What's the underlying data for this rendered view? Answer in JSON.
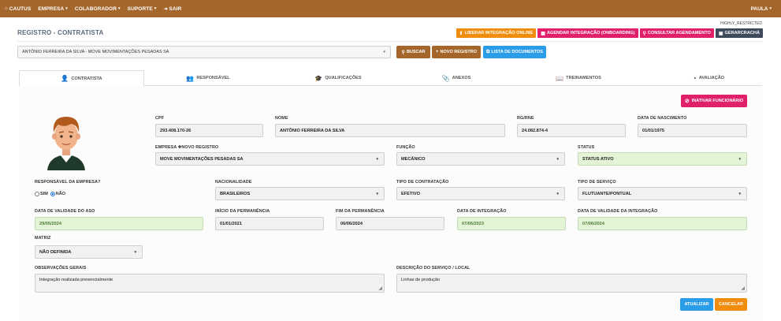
{
  "nav": {
    "items": [
      {
        "label": "CAUTUS",
        "icon": "home-icon",
        "caret": false
      },
      {
        "label": "EMPRESA",
        "icon": "",
        "caret": true
      },
      {
        "label": "COLABORADOR",
        "icon": "",
        "caret": true
      },
      {
        "label": "SUPORTE",
        "icon": "",
        "caret": true
      },
      {
        "label": "SAIR",
        "icon": "logout-icon",
        "caret": false
      }
    ],
    "user": "PAULA"
  },
  "restricted_label": "HIGHLY_RESTRICTED",
  "page_title": "REGISTRO - CONTRATISTA",
  "header_buttons": {
    "liberar": "LIBERAR INTEGRAÇÃO ONLINE",
    "agendar": "AGENDAR INTEGRAÇÃO (ONBOARDING)",
    "consultar": "CONSULTAR AGENDAMENTO",
    "cracha": "GERARCRACHÁ"
  },
  "employee_select": "ANTÔNIO FERREIRA DA SILVA - MOVE MOVIMENTAÇÕES PESADAS SA",
  "actions": {
    "buscar": "BUSCAR",
    "novo": "NOVO REGISTRO",
    "lista": "LISTA DE DOCUMENTOS"
  },
  "tabs": [
    "CONTRATISTA",
    "RESPONSÁVEL",
    "QUALIFICAÇÕES",
    "ANEXOS",
    "TREINAMENTOS",
    "AVALIAÇÃO"
  ],
  "inativar": "INATIVAR FUNCIONÁRIO",
  "form": {
    "cpf": {
      "label": "CPF",
      "value": "293.408.170-26"
    },
    "nome": {
      "label": "NOME",
      "value": "ANTÔNIO FERREIRA DA SILVA"
    },
    "rg": {
      "label": "RG/RNE",
      "value": "24.082.874-4"
    },
    "nascimento": {
      "label": "DATA DE NASCIMENTO",
      "value": "01/01/1975"
    },
    "empresa": {
      "label": "EMPRESA",
      "novo": "NOVO REGISTRO",
      "value": "MOVE MOVIMENTAÇÕES PESADAS SA"
    },
    "funcao": {
      "label": "FUNÇÃO",
      "value": "MECÂNICO"
    },
    "status": {
      "label": "STATUS",
      "value": "STATUS ATIVO"
    },
    "responsavel": {
      "label": "RESPONSÁVEL DA EMPRESA?",
      "sim": "SIM",
      "nao": "NÃO"
    },
    "nacionalidade": {
      "label": "NACIONALIDADE",
      "value": "BRASILEIROS"
    },
    "contratacao": {
      "label": "TIPO DE CONTRATAÇÃO",
      "value": "EFETIVO"
    },
    "servico": {
      "label": "TIPO DE SERVIÇO",
      "value": "FLUTUANTE/PONTUAL"
    },
    "validade_aso": {
      "label": "DATA DE VALIDADE DO ASO",
      "value": "29/05/2024"
    },
    "inicio": {
      "label": "INÍCIO DA PERMANÊNCIA",
      "value": "01/01/2021"
    },
    "fim": {
      "label": "FIM DA PERMANÊNCIA",
      "value": "06/06/2024"
    },
    "integracao": {
      "label": "DATA DE INTEGRAÇÃO",
      "value": "07/06/2023"
    },
    "validade_integracao": {
      "label": "DATA DE VALIDADE DA INTEGRAÇÃO",
      "value": "07/06/2024"
    },
    "matriz": {
      "label": "MATRIZ",
      "value": "NÃO DEFINIDA"
    },
    "observacoes": {
      "label": "OBSERVAÇÕES GERAIS",
      "value": "Integração realizada presencialmente"
    },
    "descricao": {
      "label": "DESCRIÇÃO DO SERVIÇO / LOCAL",
      "value": "Linhas de produção"
    }
  },
  "footer": {
    "atualizar": "ATUALIZAR",
    "cancelar": "CANCELAR"
  },
  "colors": {
    "nav_brown": "#a4662b",
    "orange": "#f08d0e",
    "magenta": "#e0206b",
    "dark": "#3d4a5c",
    "blue": "#2b9ce8",
    "green_field": "#e4f4d7"
  }
}
